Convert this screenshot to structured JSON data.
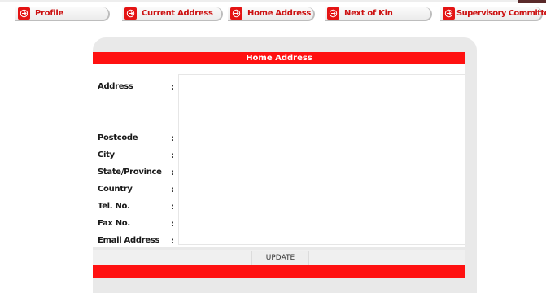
{
  "colors": {
    "accent": "#ff1111",
    "tab_text": "#cc1111",
    "panel": "#e9e9e9"
  },
  "tabs": [
    {
      "label": "Profile",
      "icon": "arrow-right-icon"
    },
    {
      "label": "Current Address",
      "icon": "arrow-right-icon"
    },
    {
      "label": "Home Address",
      "icon": "arrow-right-icon"
    },
    {
      "label": "Next of Kin",
      "icon": "arrow-right-icon"
    },
    {
      "label": "Supervisory Committee",
      "icon": "arrow-right-icon"
    }
  ],
  "form": {
    "title": "Home Address",
    "separator": ":",
    "fields": [
      {
        "label": "Address",
        "value": ""
      },
      {
        "label": "Postcode"
      },
      {
        "label": "City"
      },
      {
        "label": "State/Province"
      },
      {
        "label": "Country"
      },
      {
        "label": "Tel. No."
      },
      {
        "label": "Fax No."
      },
      {
        "label": "Email Address"
      }
    ],
    "update_label": "UPDATE"
  }
}
